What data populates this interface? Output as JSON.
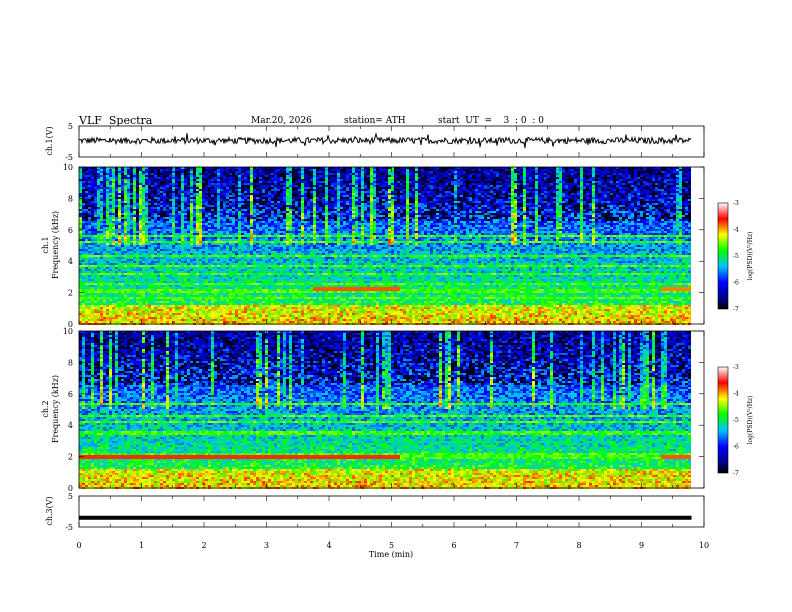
{
  "header": {
    "title": "VLF  Spectra",
    "date": "Mar.20, 2026",
    "station": "station= ATH",
    "start_ut": "start  UT  =    3  : 0  : 0"
  },
  "chart_data": [
    {
      "type": "line",
      "name": "ch1-waveform",
      "ylabel": "ch.1(V)",
      "ylim": [
        -5,
        5
      ],
      "y_ticks": [
        "5",
        "-5"
      ],
      "xlim": [
        0,
        10
      ],
      "signal": {
        "mean_volts": 0.3,
        "noise_amplitude_volts": 1.0,
        "end_min": 9.8,
        "color": "#000000"
      }
    },
    {
      "type": "heatmap",
      "name": "ch1-spectrogram",
      "ylabel": "ch.1\nFrequency (kHz)",
      "ylabel_lines": [
        "ch.1",
        "Frequency (kHz)"
      ],
      "xlim": [
        0,
        10
      ],
      "ylim": [
        0,
        10
      ],
      "y_ticks": [
        "0",
        "2",
        "4",
        "6",
        "8",
        "10"
      ],
      "data_end_min": 9.8,
      "colorbar": {
        "label": "log(PSD)(V²/Hz)",
        "range": [
          -7,
          -3
        ],
        "ticks": [
          "-3",
          "-4",
          "-5",
          "-6",
          "-7"
        ]
      },
      "lines_khz": [
        0.5,
        1.0,
        1.6,
        2.1,
        2.6,
        3.2,
        3.7,
        4.3,
        5.2,
        5.6
      ],
      "hot_bands": [
        {
          "start_min": 3.7,
          "end_min": 5.1,
          "freq_khz": 2.2,
          "level": -3.8
        },
        {
          "start_min": 9.3,
          "end_min": 9.8,
          "freq_khz": 2.2,
          "level": -3.9
        }
      ]
    },
    {
      "type": "heatmap",
      "name": "ch2-spectrogram",
      "ylabel": "ch.2\nFrequency (kHz)",
      "ylabel_lines": [
        "ch.2",
        "Frequency (kHz)"
      ],
      "xlim": [
        0,
        10
      ],
      "ylim": [
        0,
        10
      ],
      "y_ticks": [
        "0",
        "2",
        "4",
        "6",
        "8",
        "10"
      ],
      "data_end_min": 9.8,
      "colorbar": {
        "label": "log(PSD)(V²/Hz)",
        "range": [
          -7,
          -3
        ],
        "ticks": [
          "-3",
          "-4",
          "-5",
          "-6",
          "-7"
        ]
      },
      "lines_khz": [
        0.9,
        1.9,
        2.1,
        3.4,
        3.6,
        4.2,
        4.6,
        5.4
      ],
      "hot_bands": [
        {
          "start_min": 0.0,
          "end_min": 5.1,
          "freq_khz": 2.0,
          "level": -3.7
        },
        {
          "start_min": 9.3,
          "end_min": 9.8,
          "freq_khz": 2.0,
          "level": -3.8
        }
      ]
    },
    {
      "type": "line",
      "name": "ch3-waveform",
      "ylabel": "ch.3(V)",
      "ylim": [
        -5,
        5
      ],
      "y_ticks": [
        "5",
        "-5"
      ],
      "xlim": [
        0,
        10
      ],
      "signal": {
        "mean_volts": -2.0,
        "noise_amplitude_volts": 0.0,
        "end_min": 9.8,
        "color": "#000000"
      }
    }
  ],
  "x_axis": {
    "label": "Time  (min)",
    "range": [
      0,
      10
    ],
    "ticks": [
      "0",
      "1",
      "2",
      "3",
      "4",
      "5",
      "6",
      "7",
      "8",
      "9",
      "10"
    ]
  }
}
